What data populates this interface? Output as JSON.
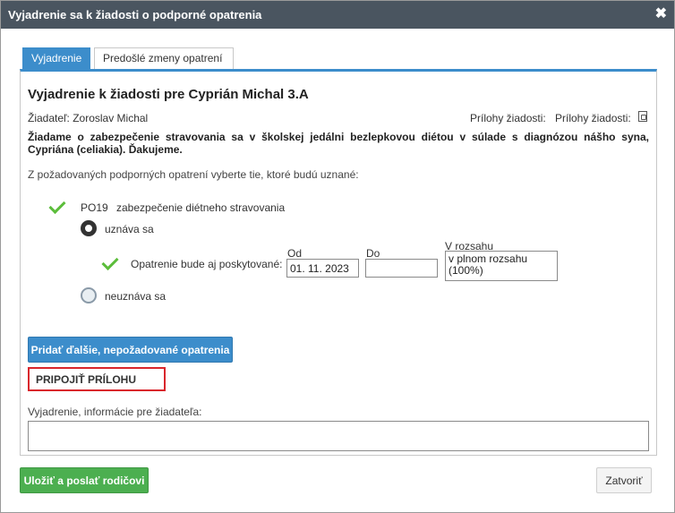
{
  "dialog": {
    "title": "Vyjadrenie sa k žiadosti o podporné opatrenia",
    "close_glyph": "✖"
  },
  "tabs": [
    {
      "label": "Vyjadrenie",
      "active": true
    },
    {
      "label": "Predošlé zmeny opatrení",
      "active": false
    }
  ],
  "content": {
    "heading": "Vyjadrenie k žiadosti pre Cyprián Michal 3.A",
    "applicant": "Žiadateľ: Zoroslav Michal",
    "attachments_label_1": "Prílohy žiadosti:",
    "attachments_label_2": "Prílohy žiadosti:",
    "request_text": "Žiadame o zabezpečenie stravovania sa v školskej jedálni bezlepkovou diétou v súlade s diagnózou nášho syna, Cypriána (celiakia). Ďakujeme.",
    "instruction": "Z požadovaných podporných opatrení vyberte tie, ktoré budú uznané:",
    "measure": {
      "code": "PO19",
      "name": "zabezpečenie diétneho stravovania",
      "option_accept": "uznáva sa",
      "option_reject": "neuznáva sa",
      "selected": "uznáva sa",
      "provided_label": "Opatrenie bude aj poskytované:",
      "from_label": "Od",
      "from_value": "01. 11. 2023",
      "to_label": "Do",
      "to_value": "",
      "range_label": "V rozsahu",
      "range_value": "v plnom rozsahu (100%)"
    },
    "add_button": "Pridať ďalšie, nepožadované opatrenia",
    "attach_button": "PRIPOJIŤ PRÍLOHU",
    "comment_label": "Vyjadrenie, informácie pre žiadateľa:",
    "comment_value": ""
  },
  "footer": {
    "save_button": "Uložiť a poslať rodičovi",
    "close_button": "Zatvoriť"
  },
  "colors": {
    "titlebar": "#4a5560",
    "primary": "#3c8dcb",
    "success": "#4caf50",
    "check": "#5cbd3b",
    "highlight": "#d9262c"
  },
  "icons": {
    "close": "close-icon",
    "attachment": "attachment-file-icon",
    "check": "checkmark-icon"
  }
}
